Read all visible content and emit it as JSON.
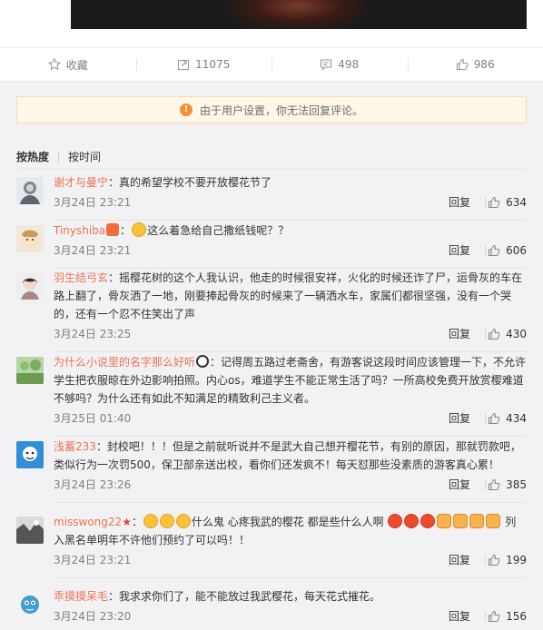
{
  "actions": {
    "collect": "收藏",
    "repost": "11075",
    "comment": "498",
    "like": "986"
  },
  "notice": "由于用户设置，你无法回复评论。",
  "sort": {
    "hot": "按热度",
    "time": "按时间"
  },
  "reply_label": "回复",
  "comments": [
    {
      "user": "谢才与曼宁",
      "text": "：真的希望学校不要开放樱花节了",
      "time": "3月24日 23:21",
      "likes": "634"
    },
    {
      "user": "Tinyshiba",
      "text": "这么着急给自己撒纸钱呢？？",
      "time": "3月24日 23:21",
      "likes": "606"
    },
    {
      "user": "羽生结弓玄",
      "text": "：摇樱花树的这个人我认识，他走的时候很安祥，火化的时候还诈了尸，运骨灰的车在路上翻了，骨灰洒了一地，刚要捧起骨灰的时候来了一辆洒水车，家属们都很坚强，没有一个哭的，还有一个忍不住笑出了声",
      "time": "3月24日 23:25",
      "likes": "430"
    },
    {
      "user": "为什么小说里的名字那么好听",
      "text": "：记得周五路过老斋舍，有游客说这段时间应该管理一下，不允许学生把衣服晾在外边影响拍照。内心os，难道学生不能正常生活了吗？一所高校免费开放赏樱难道不够吗？为什么还有如此不知满足的精致利己主义者。",
      "time": "3月25日 01:40",
      "likes": "434"
    },
    {
      "user": "浅蓄233",
      "text": "：封校吧！！！但是之前就听说并不是武大自己想开樱花节，有别的原因，那就罚款吧，类似行为一次罚500，保卫部亲送出校，看你们还发疯不！每天怼那些没素质的游客真心累！",
      "time": "3月24日 23:26",
      "likes": "385"
    },
    {
      "user": "misswong22",
      "text_a": "什么鬼 心疼我武的樱花 都是些什么人啊",
      "text_b": "列入黑名单明年不许他们预约了可以吗！！",
      "time": "3月24日 23:21",
      "likes": "199"
    },
    {
      "user": "乖摸摸呆毛",
      "text": "：我求求你们了，能不能放过我武樱花，每天花式摧花。",
      "time": "3月24日 23:20",
      "likes": "156"
    }
  ],
  "colors": {
    "username": "#eb7350",
    "panel": "#f2f2f5",
    "notice_bg": "#fef6e7",
    "warn": "#f58f33"
  }
}
